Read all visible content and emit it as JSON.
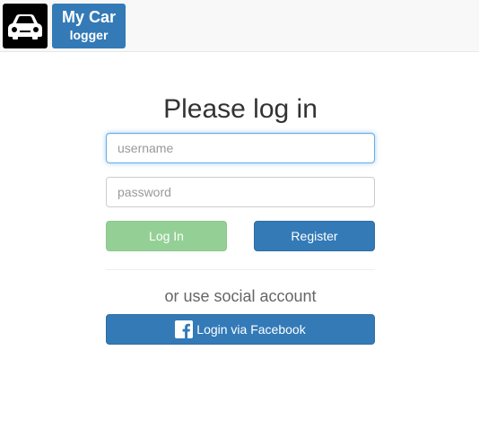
{
  "navbar": {
    "logo_icon": "car-icon",
    "brand_line1": "My Car",
    "brand_line2": "logger"
  },
  "login": {
    "heading": "Please log in",
    "username_placeholder": "username",
    "password_placeholder": "password",
    "login_label": "Log In",
    "register_label": "Register",
    "social_text": "or use social account",
    "facebook_label": "Login via Facebook",
    "facebook_icon": "facebook-icon"
  },
  "colors": {
    "primary": "#337ab7",
    "login_button": "#94d095",
    "navbar_bg": "#f8f8f8",
    "logo_bg": "#000000",
    "focus_border": "#66afe9"
  }
}
